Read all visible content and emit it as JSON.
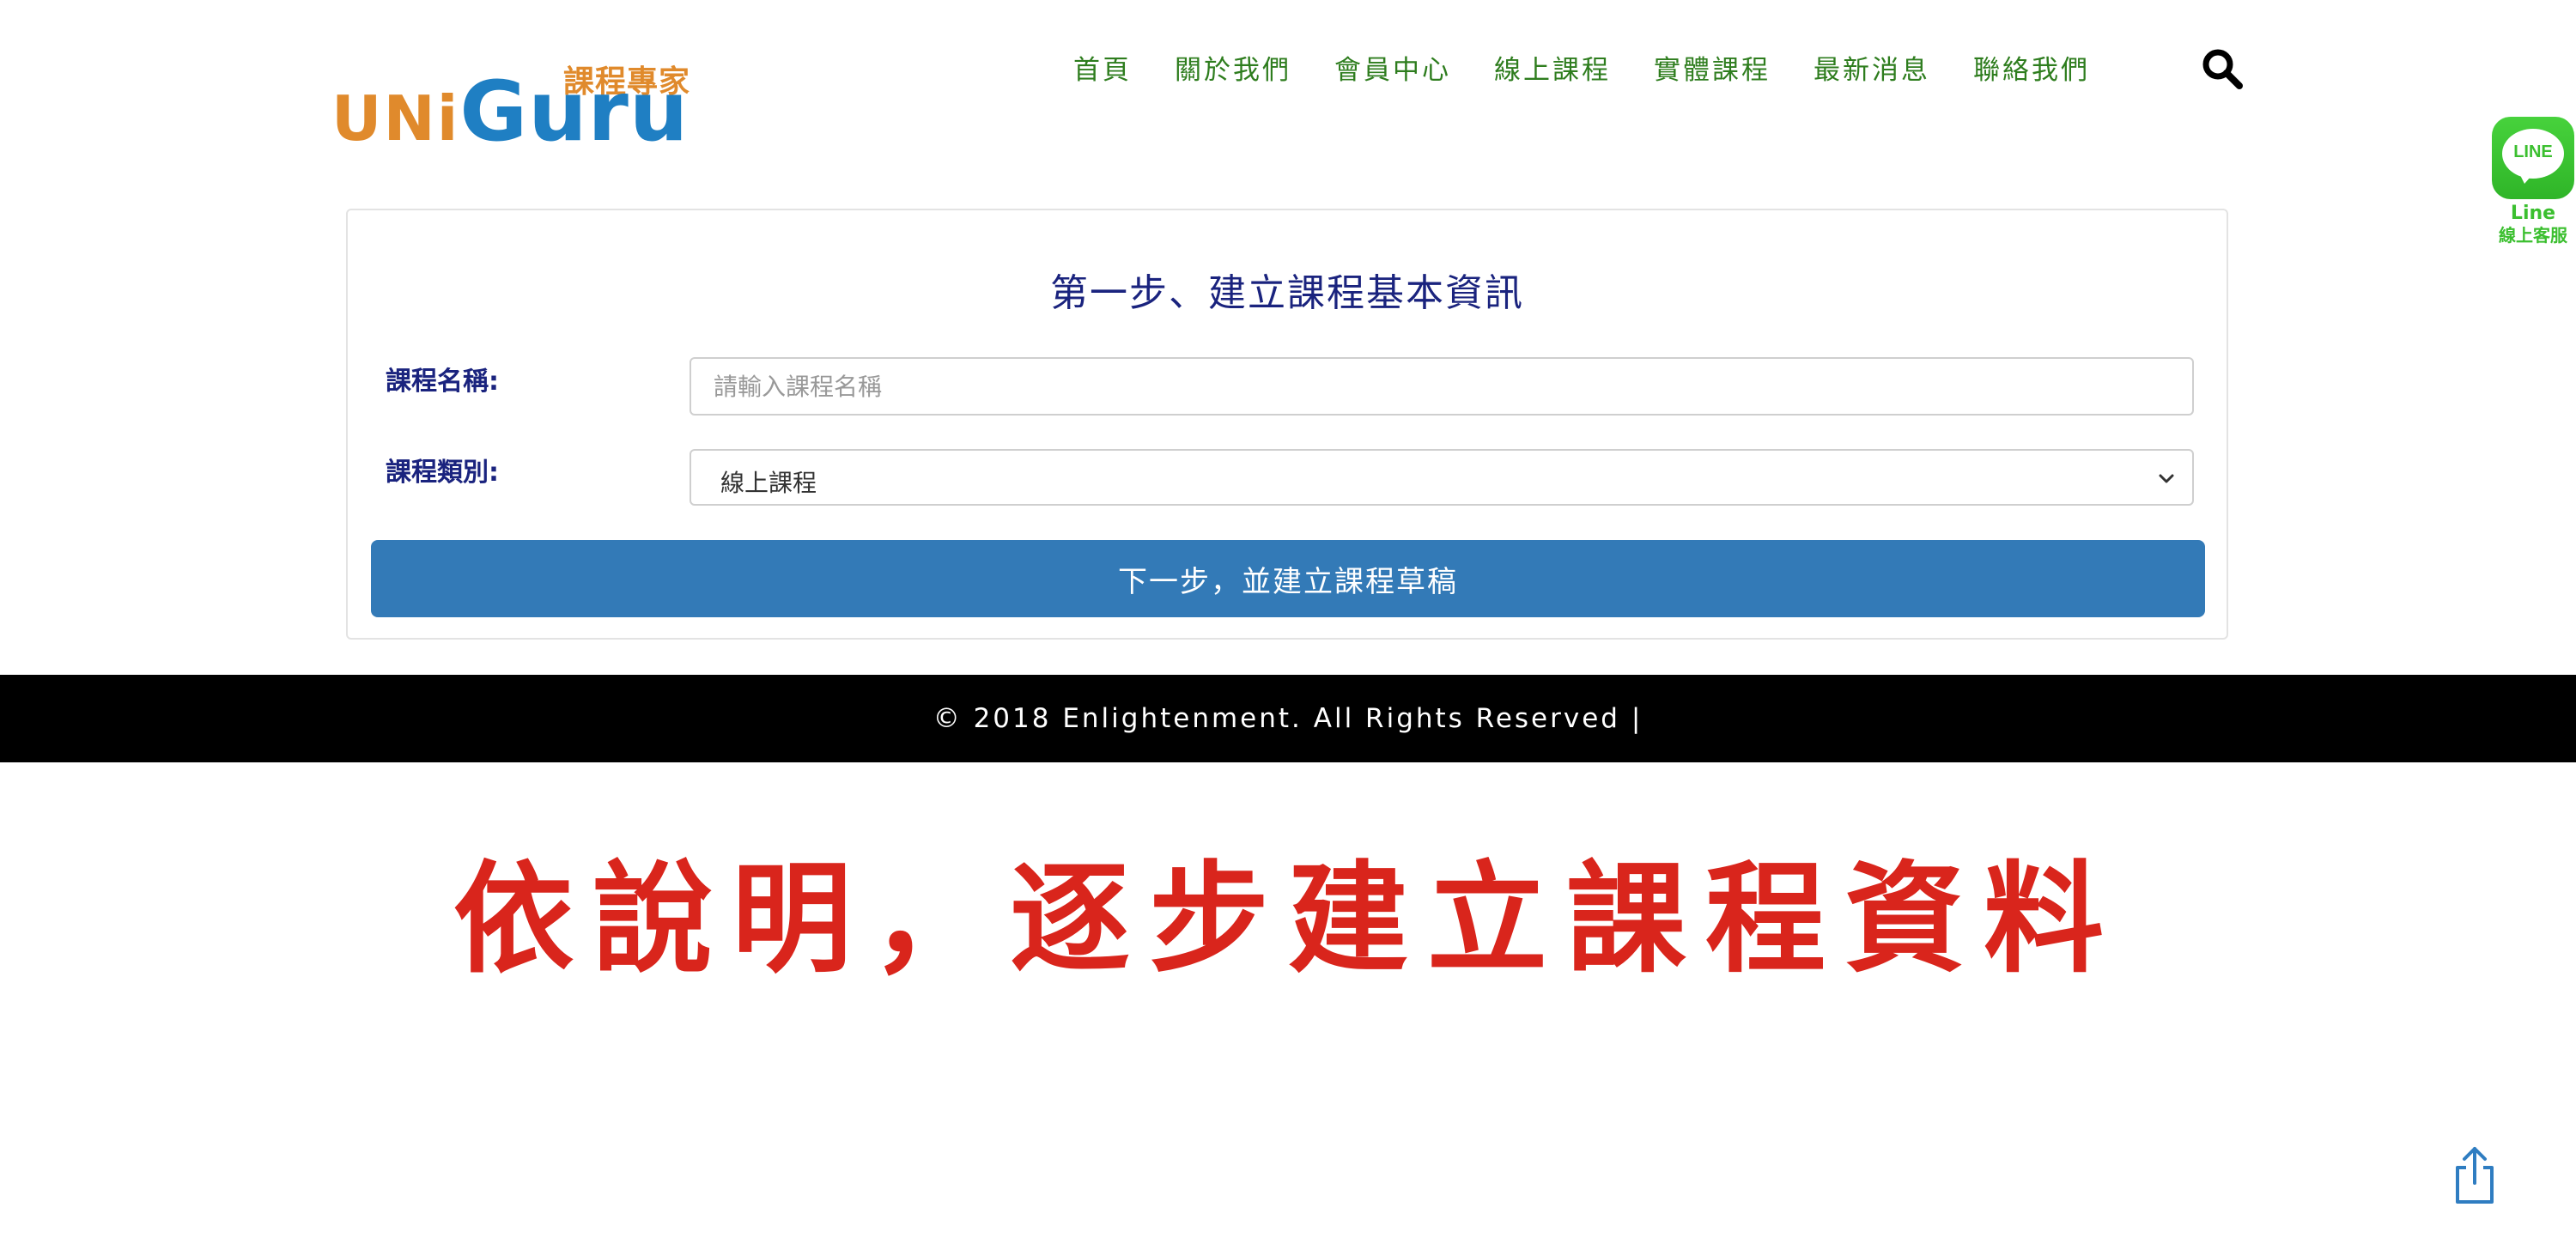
{
  "logo": {
    "tagline": "課程專家",
    "brand_part1": "UNi",
    "brand_part2": "Guru"
  },
  "nav": {
    "items": [
      {
        "label": "首頁"
      },
      {
        "label": "關於我們"
      },
      {
        "label": "會員中心"
      },
      {
        "label": "線上課程"
      },
      {
        "label": "實體課程"
      },
      {
        "label": "最新消息"
      },
      {
        "label": "聯絡我們"
      }
    ],
    "search_icon": "search-icon"
  },
  "line_widget": {
    "bubble_text": "LINE",
    "caption_1": "Line",
    "caption_2": "線上客服"
  },
  "form": {
    "title": "第一步、建立課程基本資訊",
    "name_label": "課程名稱:",
    "name_placeholder": "請輸入課程名稱",
    "name_value": "",
    "type_label": "課程類別:",
    "type_selected": "線上課程",
    "submit_label": "下一步，並建立課程草稿"
  },
  "footer": {
    "copyright": "© 2018 Enlightenment. All Rights Reserved |"
  },
  "caption": {
    "text": "依說明，逐步建立課程資料"
  },
  "colors": {
    "nav_text": "#2e7d1e",
    "title_text": "#1a237e",
    "primary_button": "#337ab7",
    "footer_bg": "#000000",
    "caption_red": "#d9251c",
    "logo_orange": "#e08a2c",
    "logo_blue": "#1f7fc3",
    "line_green": "#3bbf2f"
  },
  "icons": {
    "share": "share-icon",
    "chevron": "chevron-down-icon"
  }
}
